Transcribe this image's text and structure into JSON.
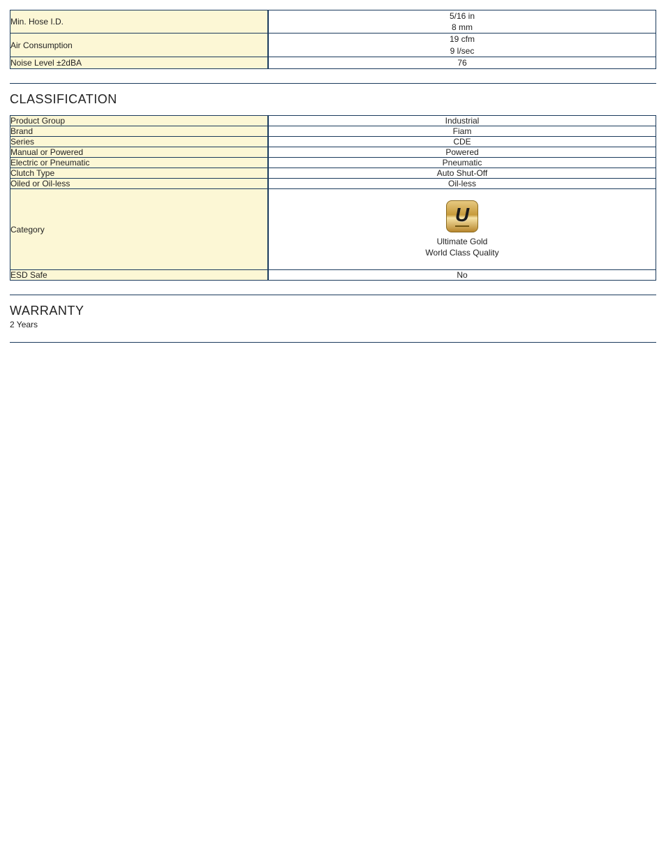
{
  "top_specs": [
    {
      "label": "Min. Hose I.D.",
      "lines": [
        "5/16 in",
        "8 mm"
      ]
    },
    {
      "label": "Air Consumption",
      "lines": [
        "19 cfm",
        "9 l/sec"
      ]
    },
    {
      "label": "Noise Level ±2dBA",
      "lines": [
        "76"
      ]
    }
  ],
  "classification": {
    "heading": "CLASSIFICATION",
    "rows": [
      {
        "label": "Product Group",
        "value": "Industrial"
      },
      {
        "label": "Brand",
        "value": "Fiam"
      },
      {
        "label": "Series",
        "value": "CDE"
      },
      {
        "label": "Manual or Powered",
        "value": "Powered"
      },
      {
        "label": "Electric or Pneumatic",
        "value": "Pneumatic"
      },
      {
        "label": "Clutch Type",
        "value": "Auto Shut-Off"
      },
      {
        "label": "Oiled or Oil-less",
        "value": "Oil-less"
      },
      {
        "label": "Category",
        "badge": {
          "letter": "U",
          "line1": "Ultimate Gold",
          "line2": "World Class Quality"
        }
      },
      {
        "label": "ESD Safe",
        "value": "No"
      }
    ]
  },
  "warranty": {
    "heading": "WARRANTY",
    "text": "2 Years"
  }
}
